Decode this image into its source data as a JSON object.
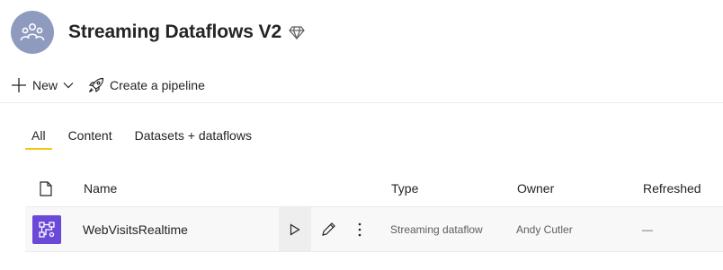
{
  "workspace": {
    "title": "Streaming Dataflows V2",
    "avatar_icon": "people-group-icon",
    "premium_icon": "diamond-icon",
    "avatar_color": "#8e9bbf"
  },
  "toolbar": {
    "new_label": "New",
    "pipeline_label": "Create a pipeline"
  },
  "tabs": [
    {
      "label": "All",
      "active": true
    },
    {
      "label": "Content",
      "active": false
    },
    {
      "label": "Datasets + dataflows",
      "active": false
    }
  ],
  "table": {
    "columns": {
      "icon": "file-icon",
      "name": "Name",
      "type": "Type",
      "owner": "Owner",
      "refreshed": "Refreshed"
    },
    "rows": [
      {
        "name": "WebVisitsRealtime",
        "type": "Streaming dataflow",
        "owner": "Andy Cutler",
        "refreshed": "—",
        "icon": "streaming-dataflow-icon",
        "icon_color": "#6a49d8"
      }
    ]
  },
  "colors": {
    "active_tab_underline": "#f2c811",
    "row_background": "#f8f8f8"
  }
}
